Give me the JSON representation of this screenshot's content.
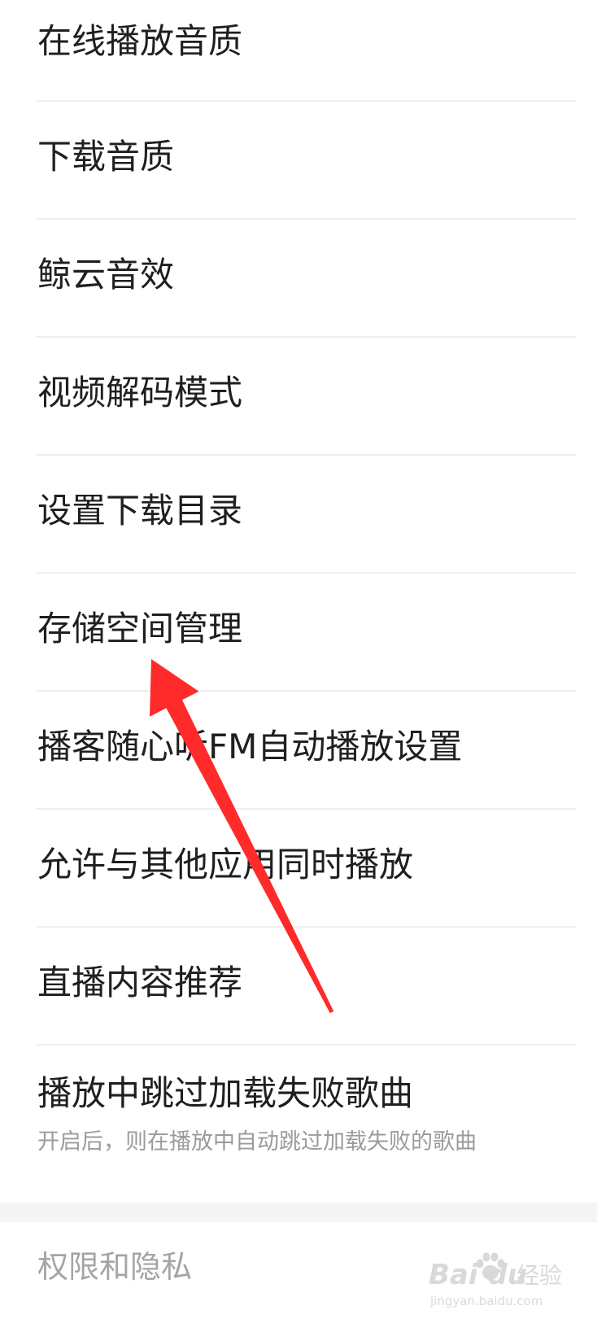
{
  "settings": {
    "items": [
      {
        "label": "在线播放音质"
      },
      {
        "label": "下载音质"
      },
      {
        "label": "鲸云音效"
      },
      {
        "label": "视频解码模式"
      },
      {
        "label": "设置下载目录"
      },
      {
        "label": "存储空间管理"
      },
      {
        "label": "播客随心听FM自动播放设置"
      },
      {
        "label": "允许与其他应用同时播放"
      },
      {
        "label": "直播内容推荐"
      }
    ],
    "skip_failed": {
      "label": "播放中跳过加载失败歌曲",
      "description": "开启后，则在播放中自动跳过加载失败的歌曲"
    }
  },
  "section": {
    "title": "权限和隐私"
  },
  "annotation": {
    "arrow_color": "#ff2a2a"
  },
  "watermark": {
    "brand": "Bai du",
    "brand_cn": "经验",
    "url": "jingyan.baidu.com"
  }
}
